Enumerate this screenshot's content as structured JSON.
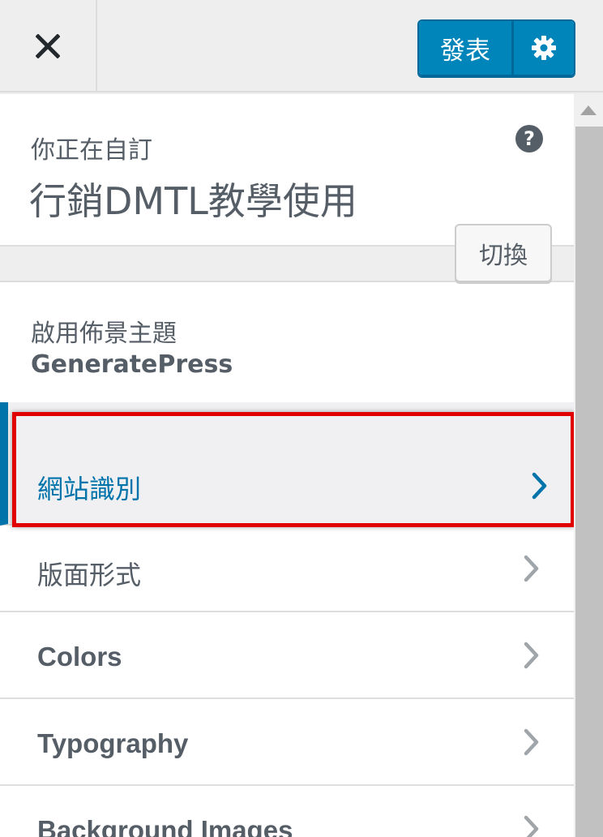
{
  "header": {
    "close_icon": "close-icon",
    "publish_label": "發表",
    "settings_icon": "gear-icon"
  },
  "info": {
    "label": "你正在自訂",
    "site_title": "行銷DMTL教學使用",
    "help_icon": "help-icon",
    "help_glyph": "?"
  },
  "theme": {
    "label": "啟用佈景主題",
    "name": "GeneratePress",
    "change_label": "切換"
  },
  "nav": {
    "items": [
      {
        "label": "網站識別",
        "active": true
      },
      {
        "label": "版面形式",
        "active": false
      },
      {
        "label": "Colors",
        "active": false
      },
      {
        "label": "Typography",
        "active": false
      },
      {
        "label": "Background Images",
        "active": false
      }
    ]
  },
  "colors": {
    "accent": "#0073aa",
    "publish": "#0085ba",
    "highlight": "#e00000"
  }
}
